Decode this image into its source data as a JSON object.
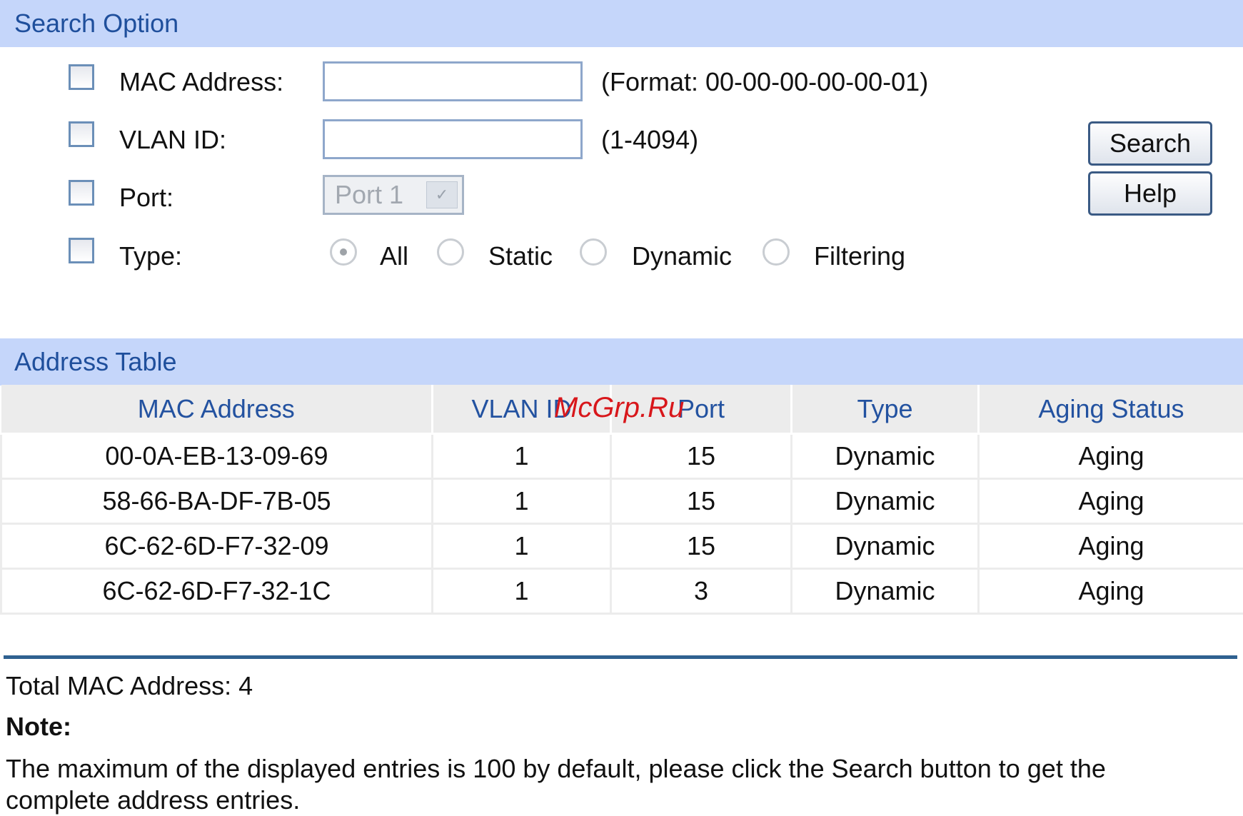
{
  "search_option": {
    "header": "Search Option",
    "mac_label": "MAC Address:",
    "mac_value": "",
    "mac_hint": "(Format: 00-00-00-00-00-01)",
    "vlan_label": "VLAN ID:",
    "vlan_value": "",
    "vlan_hint": "(1-4094)",
    "port_label": "Port:",
    "port_selected": "Port 1",
    "type_label": "Type:",
    "type_options": [
      "All",
      "Static",
      "Dynamic",
      "Filtering"
    ],
    "type_selected": "All",
    "search_button": "Search",
    "help_button": "Help"
  },
  "address_table": {
    "header": "Address Table",
    "columns": [
      "MAC Address",
      "VLAN ID",
      "Port",
      "Type",
      "Aging Status"
    ],
    "rows": [
      [
        "00-0A-EB-13-09-69",
        "1",
        "15",
        "Dynamic",
        "Aging"
      ],
      [
        "58-66-BA-DF-7B-05",
        "1",
        "15",
        "Dynamic",
        "Aging"
      ],
      [
        "6C-62-6D-F7-32-09",
        "1",
        "15",
        "Dynamic",
        "Aging"
      ],
      [
        "6C-62-6D-F7-32-1C",
        "1",
        "3",
        "Dynamic",
        "Aging"
      ]
    ]
  },
  "footer": {
    "total": "Total MAC Address: 4",
    "note_title": "Note:",
    "note_text_line1": "The maximum of the displayed entries is 100 by default, please click the Search button to get the",
    "note_text_line2": "complete address entries."
  },
  "watermark": "McGrp.Ru",
  "colors": {
    "header_bg": "#c5d6fa",
    "header_text": "#1f4f9c",
    "table_header_text": "#2352a0",
    "divider": "#2f6190",
    "watermark": "#d8171b"
  }
}
